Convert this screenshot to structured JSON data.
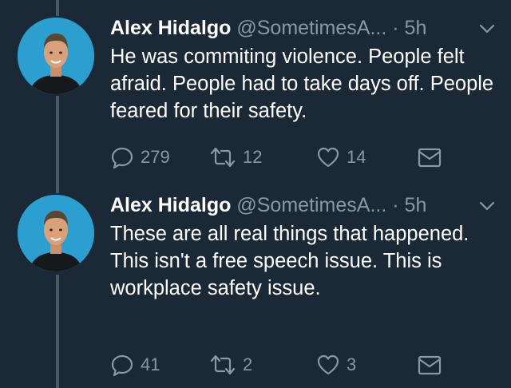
{
  "tweets": [
    {
      "name": "Alex Hidalgo",
      "handle": "@SometimesA...",
      "separator": "·",
      "time": "5h",
      "text": "He was commiting violence. People felt afraid. People had to take days off. People feared for their safety.",
      "replies": "279",
      "retweets": "12",
      "likes": "14"
    },
    {
      "name": "Alex Hidalgo",
      "handle": "@SometimesA...",
      "separator": "·",
      "time": "5h",
      "text": "These are all real things that happened. This isn't a free speech issue. This is workplace safety issue.",
      "replies": "41",
      "retweets": "2",
      "likes": "3"
    }
  ],
  "icons": {
    "reply": "reply-icon",
    "retweet": "retweet-icon",
    "like": "heart-icon",
    "message": "envelope-icon",
    "more": "chevron-down-icon"
  },
  "colors": {
    "background": "#1b2836",
    "text": "#ffffff",
    "secondary": "#8899a6",
    "thread_line": "#4a5967",
    "avatar_bg": "#2a9fd0"
  }
}
